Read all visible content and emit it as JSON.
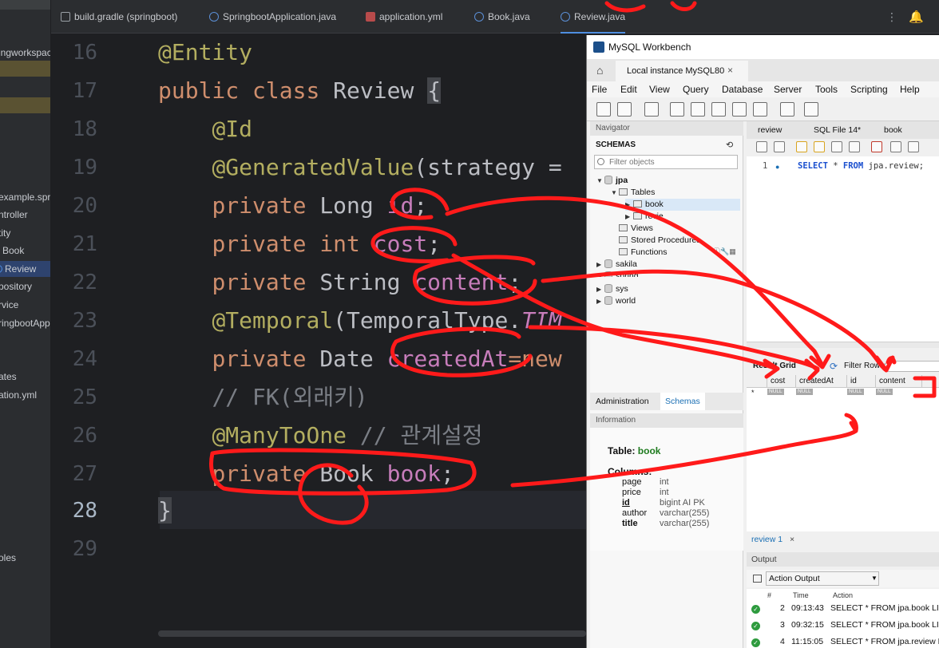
{
  "ide": {
    "tabs": [
      {
        "label": "build.gradle (springboot)",
        "icon": "gradle-icon"
      },
      {
        "label": "SpringbootApplication.java",
        "icon": "java-class-icon"
      },
      {
        "label": "application.yml",
        "icon": "yaml-icon"
      },
      {
        "label": "Book.java",
        "icon": "java-class-icon"
      },
      {
        "label": "Review.java",
        "icon": "java-class-icon"
      }
    ],
    "project": {
      "items": [
        {
          "label": "ingworkspac"
        },
        {
          "label": "example.sprir"
        },
        {
          "label": "ntroller"
        },
        {
          "label": "tity"
        },
        {
          "label": "Book"
        },
        {
          "label": "Review"
        },
        {
          "label": "pository"
        },
        {
          "label": "rvice"
        },
        {
          "label": "ringbootApp"
        },
        {
          "label": "ates"
        },
        {
          "label": "ation.yml"
        },
        {
          "label": "oles"
        }
      ]
    },
    "line_numbers": [
      "16",
      "17",
      "18",
      "19",
      "20",
      "21",
      "22",
      "23",
      "24",
      "25",
      "26",
      "27",
      "28",
      "29"
    ],
    "code": {
      "l16": {
        "ann": "@Entity"
      },
      "l17": {
        "kw1": "public",
        "kw2": "class",
        "name": "Review",
        "brace": "{"
      },
      "l18": {
        "ann": "@Id"
      },
      "l19": {
        "ann": "@GeneratedValue",
        "rest": "(strategy ="
      },
      "l20": {
        "kw": "private",
        "type": "Long",
        "field": "id",
        "semi": ";"
      },
      "l21": {
        "kw": "private",
        "type": "int",
        "field": "cost",
        "semi": ";"
      },
      "l22": {
        "kw": "private",
        "type": "String",
        "field": "content",
        "semi": ";"
      },
      "l23": {
        "ann": "@Temporal",
        "rest": "(TemporalType.",
        "const": "TIM"
      },
      "l24": {
        "kw": "private",
        "type": "Date",
        "field": "createdAt",
        "rest": "=new"
      },
      "l25": {
        "comment": "// FK(외래키)"
      },
      "l26": {
        "ann": "@ManyToOne",
        "comment": "// 관계설정"
      },
      "l27": {
        "kw": "private",
        "type": "Book",
        "field": "book",
        "semi": ";"
      },
      "l28": {
        "brace": "}"
      }
    }
  },
  "workbench": {
    "title": "MySQL Workbench",
    "connection_tab": "Local instance MySQL80",
    "close": "×",
    "menu": [
      "File",
      "Edit",
      "View",
      "Query",
      "Database",
      "Server",
      "Tools",
      "Scripting",
      "Help"
    ],
    "navigator_header": "Navigator",
    "schemas_label": "SCHEMAS",
    "filter_placeholder": "Filter objects",
    "tree": {
      "jpa": "jpa",
      "tables": "Tables",
      "book": "book",
      "review": "revie",
      "views": "Views",
      "stored_procedures": "Stored Procedures",
      "functions": "Functions",
      "sakila": "sakila",
      "spring": "spring",
      "sys": "sys",
      "world": "world"
    },
    "admin_tab": "Administration",
    "schemas_tab": "Schemas",
    "information_header": "Information",
    "info": {
      "table_label": "Table:",
      "table_name": "book",
      "columns_label": "Columns:",
      "columns": [
        {
          "name": "page",
          "type": "int"
        },
        {
          "name": "price",
          "type": "int"
        },
        {
          "name": "id",
          "type": "bigint AI PK"
        },
        {
          "name": "author",
          "type": "varchar(255)"
        },
        {
          "name": "title",
          "type": "varchar(255)"
        }
      ]
    },
    "query_tabs": [
      "review",
      "SQL File 14*",
      "book"
    ],
    "sql": {
      "line": "1",
      "dot": "●",
      "kw1": "SELECT",
      "mid": " * ",
      "kw2": "FROM",
      "rest": " jpa.review;"
    },
    "result": {
      "label": "Result Grid",
      "filter_label": "Filter Rows:",
      "columns": [
        "cost",
        "createdAt",
        "id",
        "content"
      ],
      "null": "NULL",
      "star": "*"
    },
    "result_tab": "review 1",
    "output_header": "Output",
    "output_select": "Action Output",
    "output_columns": [
      "#",
      "Time",
      "Action"
    ],
    "output_rows": [
      {
        "n": "2",
        "time": "09:13:43",
        "action": "SELECT * FROM jpa.book LIMIT"
      },
      {
        "n": "3",
        "time": "09:32:15",
        "action": "SELECT * FROM jpa.book LIMIT"
      },
      {
        "n": "4",
        "time": "11:15:05",
        "action": "SELECT * FROM jpa.review LIMIT"
      }
    ]
  },
  "colors": {
    "ide_bg": "#1e1f22",
    "annotation": "#b3ae60",
    "keyword": "#cf8e6d",
    "field": "#c77dbb",
    "scribble": "#ff1a1a"
  }
}
